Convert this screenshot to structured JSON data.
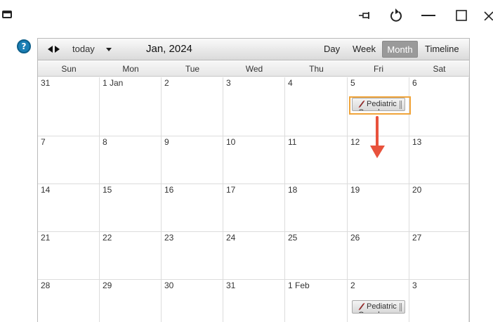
{
  "calendar": {
    "today_label": "today",
    "month_title": "Jan, 2024",
    "views": {
      "day": "Day",
      "week": "Week",
      "month": "Month",
      "timeline": "Timeline"
    },
    "active_view": "Month",
    "days_of_week": [
      "Sun",
      "Mon",
      "Tue",
      "Wed",
      "Thu",
      "Fri",
      "Sat"
    ],
    "weeks": [
      [
        "31",
        "1 Jan",
        "2",
        "3",
        "4",
        "5",
        "6"
      ],
      [
        "7",
        "8",
        "9",
        "10",
        "11",
        "12",
        "13"
      ],
      [
        "14",
        "15",
        "16",
        "17",
        "18",
        "19",
        "20"
      ],
      [
        "21",
        "22",
        "23",
        "24",
        "25",
        "26",
        "27"
      ],
      [
        "28",
        "29",
        "30",
        "31",
        "1 Feb",
        "2",
        "3"
      ]
    ],
    "events": [
      {
        "title": "Pediatric",
        "subtitle": "Grand",
        "week": 0,
        "day": 5,
        "highlighted": true
      },
      {
        "title": "Pediatric",
        "subtitle": "Grand",
        "week": 4,
        "day": 5,
        "highlighted": false
      }
    ]
  },
  "icons": {
    "app": "window-icon",
    "pin": "pin-icon",
    "refresh": "refresh-icon",
    "minimize": "minimize-icon",
    "maximize": "maximize-icon",
    "close": "close-icon",
    "help": "help-icon",
    "event": "no-edit-icon"
  },
  "colors": {
    "highlight": "#f0a43a",
    "arrow": "#e8523c",
    "help": "#1b7fb5",
    "active_view_bg": "#9a9a9a"
  },
  "help_label": "?"
}
